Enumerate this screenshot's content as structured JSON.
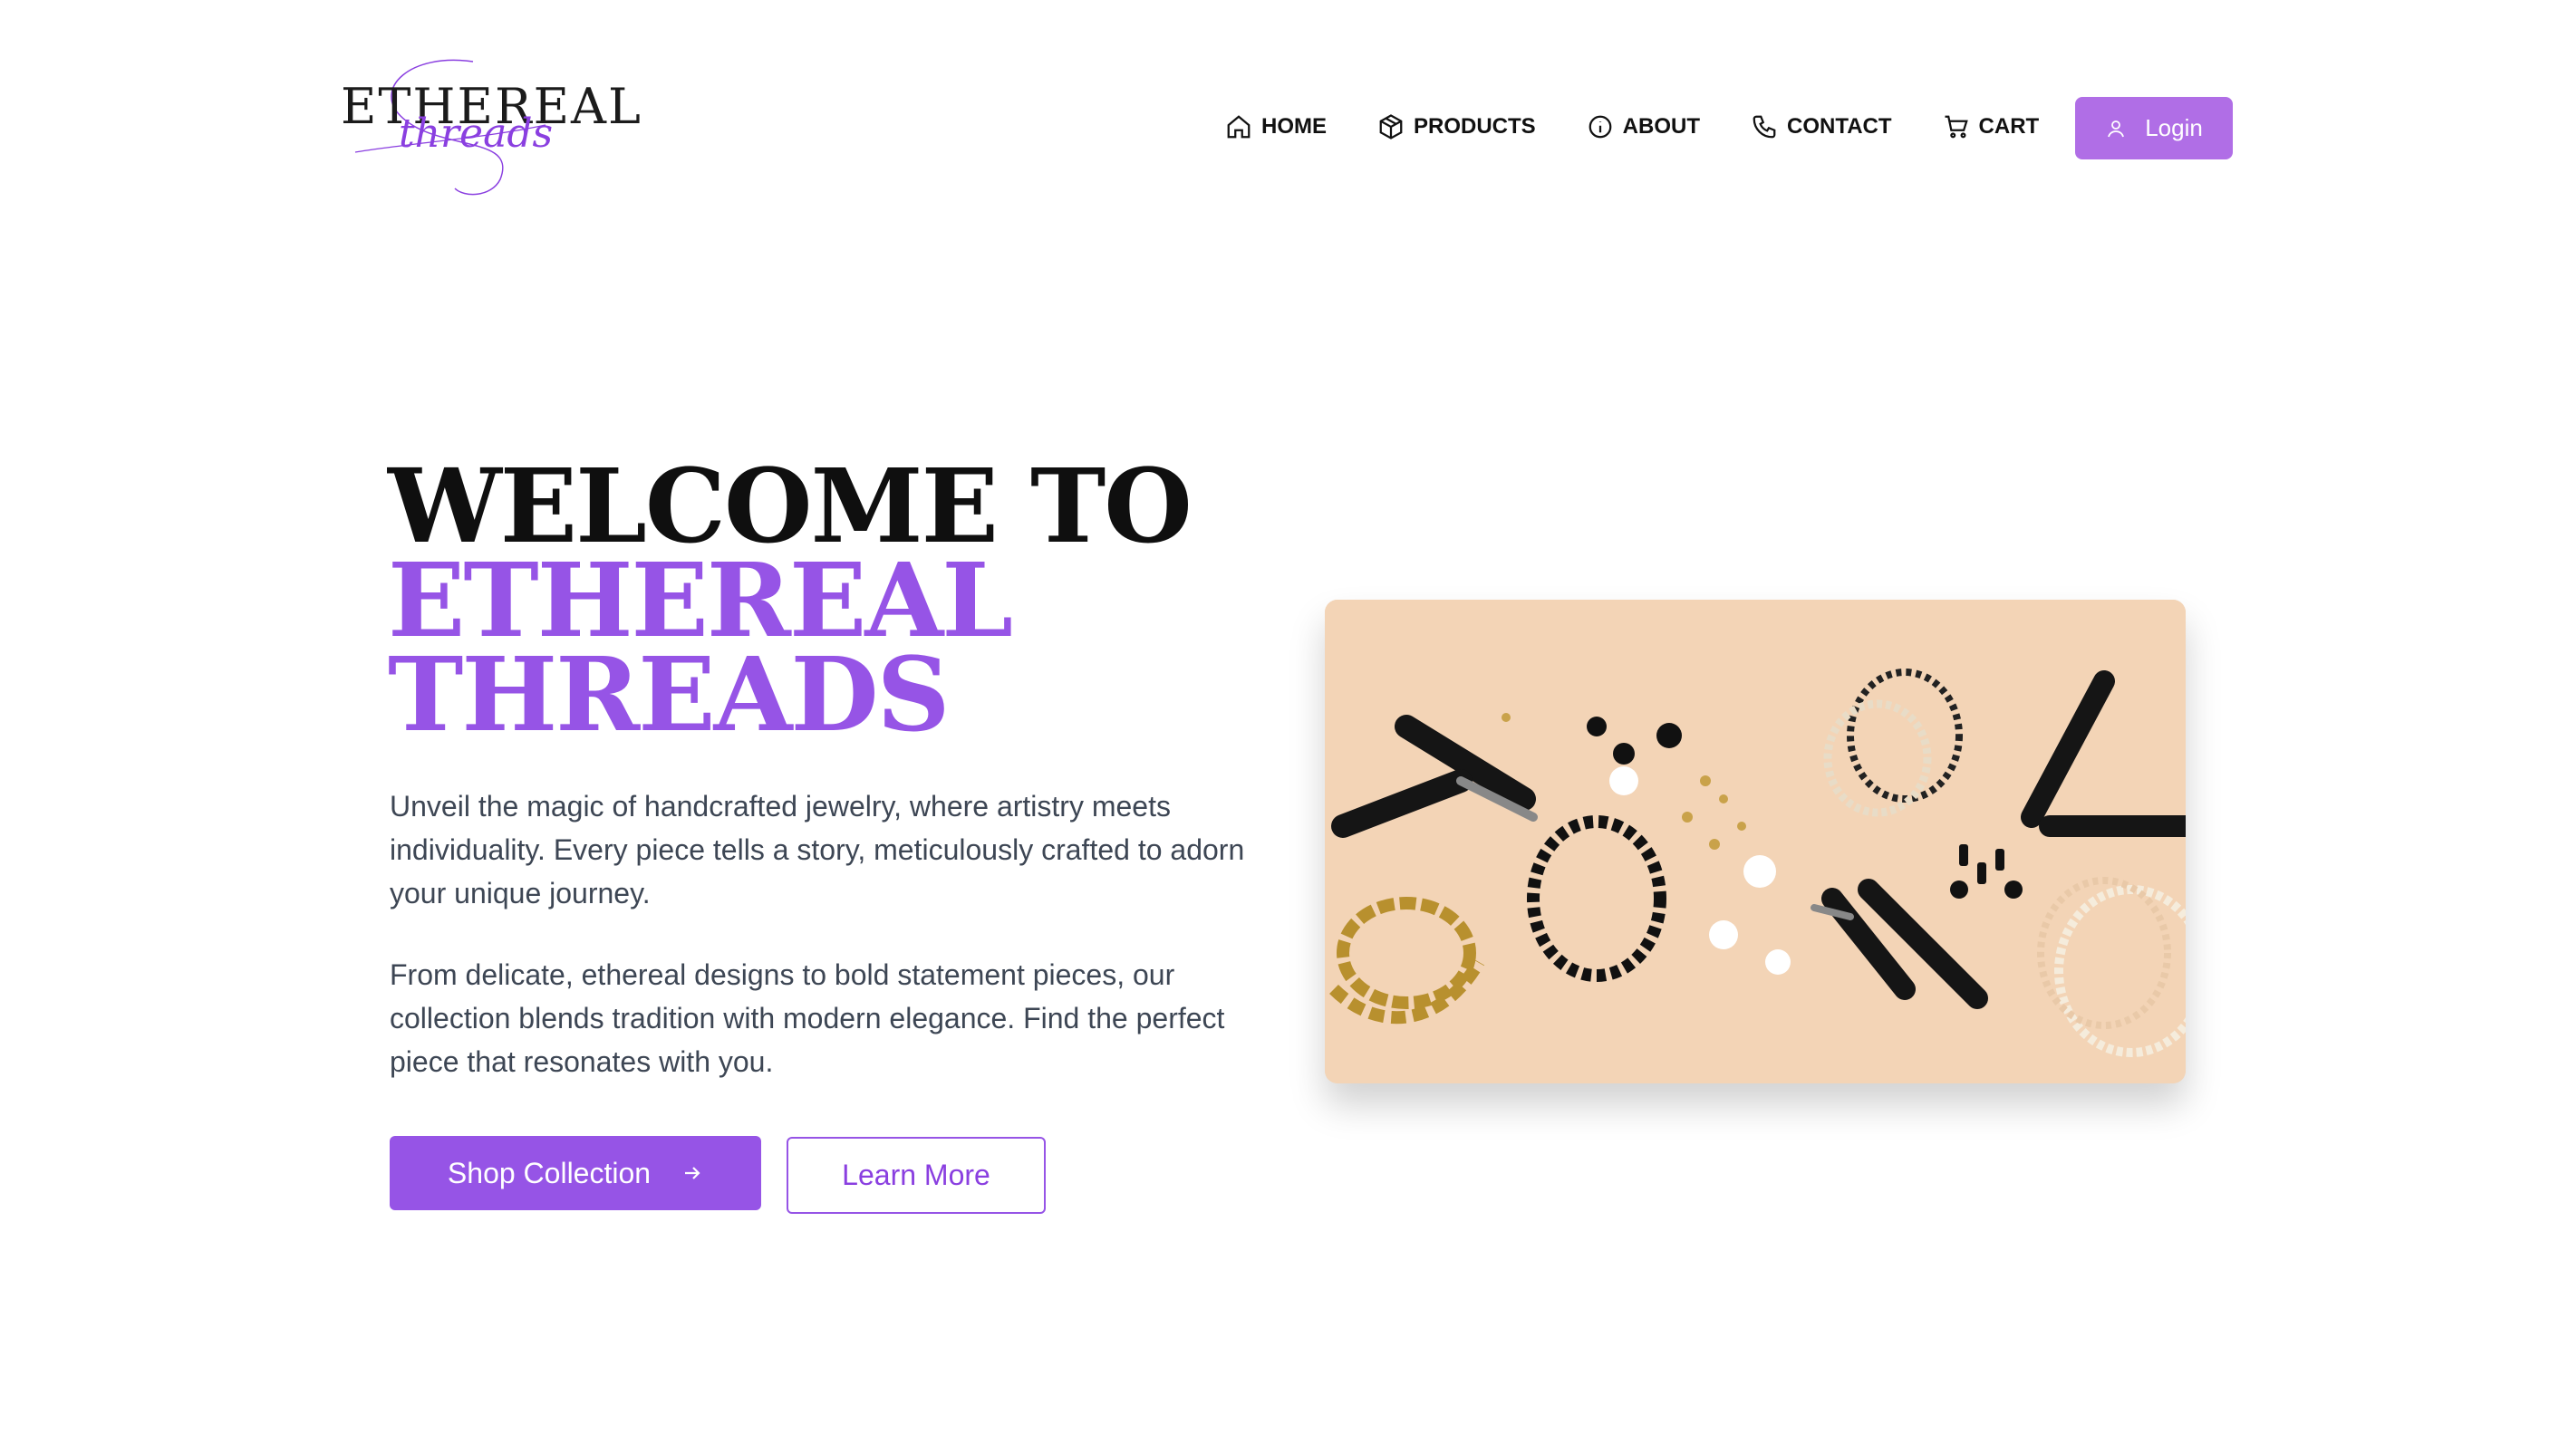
{
  "brand": {
    "logo_main": "ETHEREAL",
    "logo_script": "threads",
    "accent_color": "#9654e6",
    "button_color": "#b06ee6"
  },
  "nav": {
    "items": [
      {
        "label": "HOME",
        "icon": "home-icon"
      },
      {
        "label": "PRODUCTS",
        "icon": "box-icon"
      },
      {
        "label": "ABOUT",
        "icon": "info-icon"
      },
      {
        "label": "CONTACT",
        "icon": "phone-icon"
      },
      {
        "label": "CART",
        "icon": "cart-icon"
      }
    ],
    "login_label": "Login",
    "login_icon": "user-icon"
  },
  "hero": {
    "title_line1": "WELCOME TO",
    "title_line2": "ETHEREAL",
    "title_line3": "THREADS",
    "paragraph1": "Unveil the magic of handcrafted jewelry, where artistry meets individuality. Every piece tells a story, meticulously crafted to adorn your unique journey.",
    "paragraph2": "From delicate, ethereal designs to bold statement pieces, our collection blends tradition with modern elegance. Find the perfect piece that resonates with you.",
    "primary_button": "Shop Collection",
    "primary_button_icon": "arrow-right-icon",
    "secondary_button": "Learn More"
  }
}
